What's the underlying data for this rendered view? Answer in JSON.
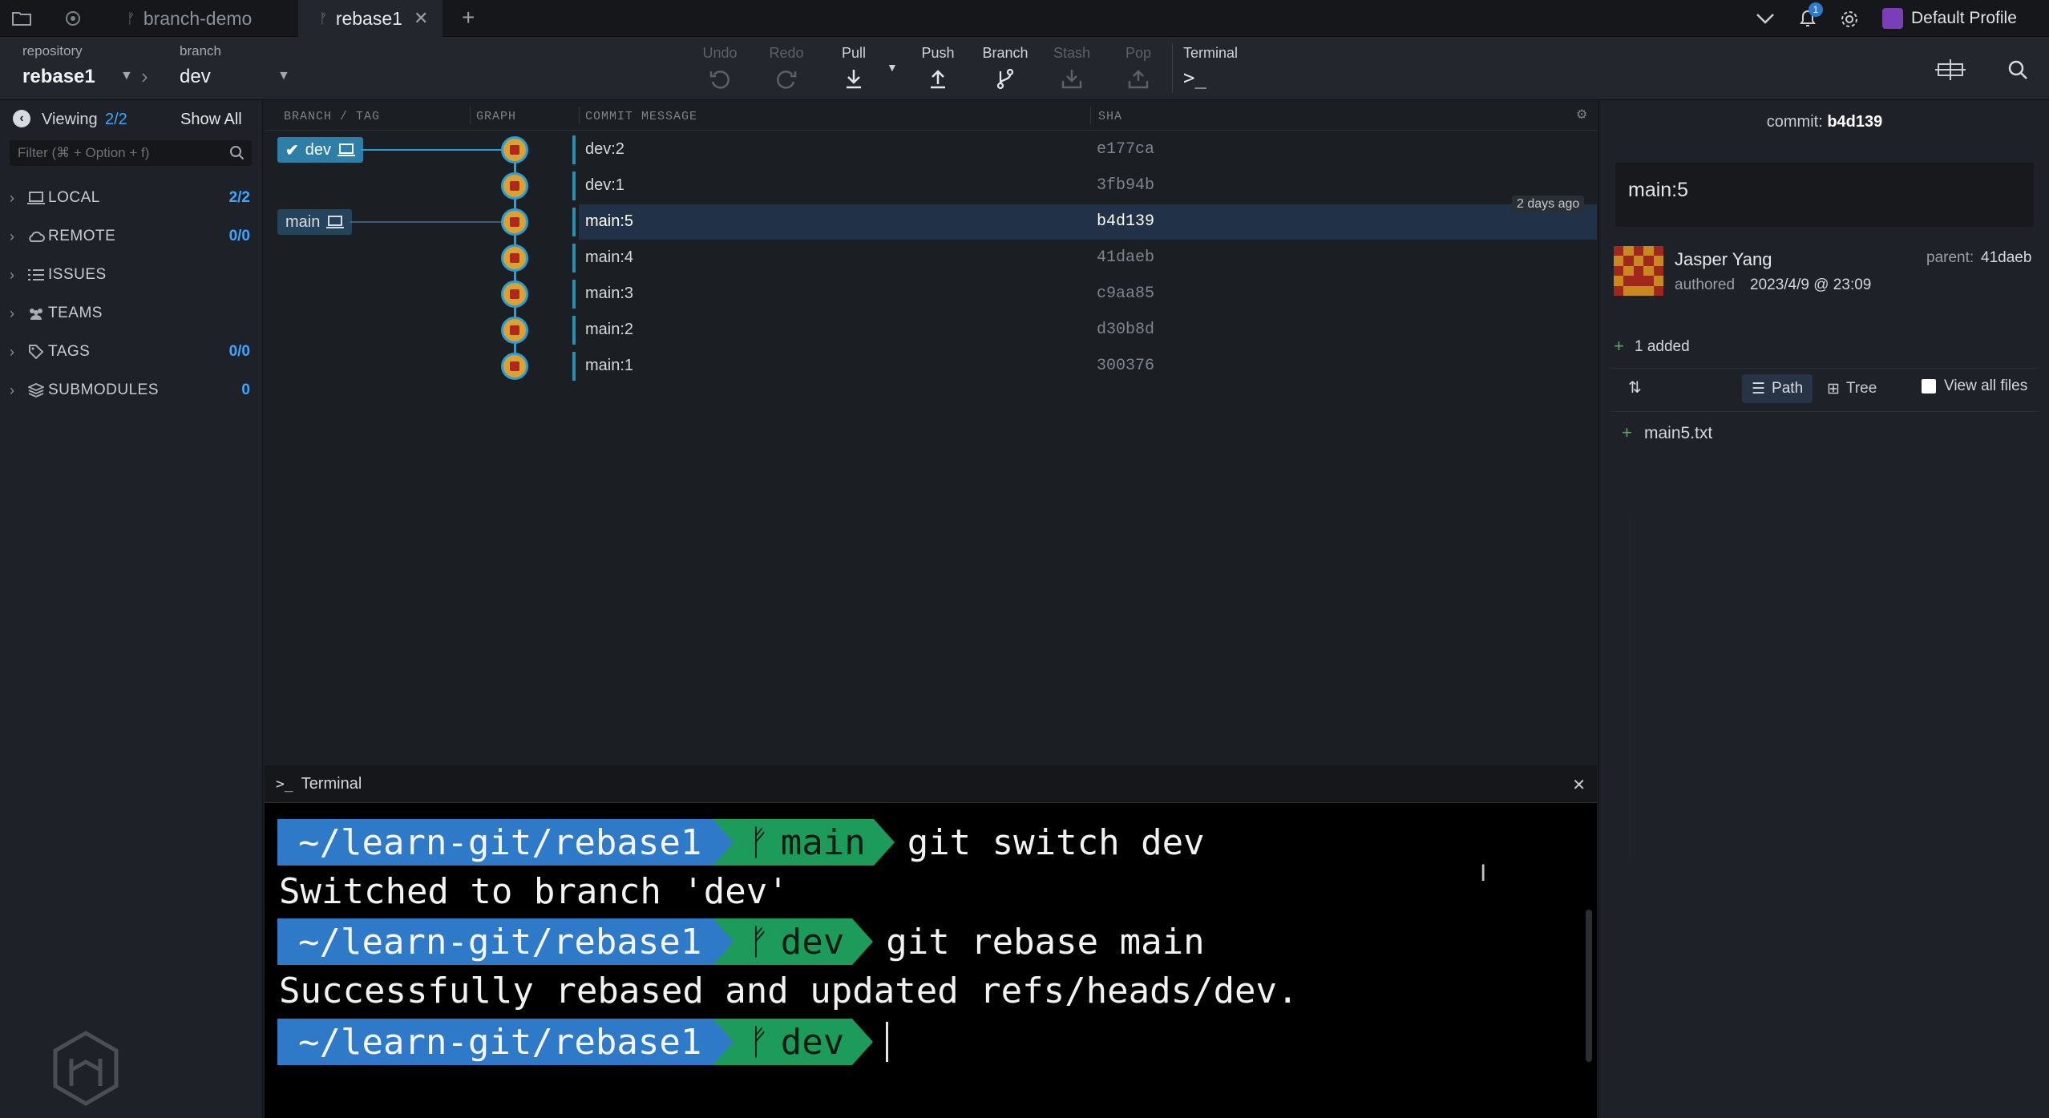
{
  "tabbar": {
    "tabs": [
      {
        "label": "branch-demo"
      },
      {
        "label": "rebase1"
      }
    ],
    "profile_label": "Default Profile",
    "notification_count": "1"
  },
  "toolbar": {
    "repo_caption": "repository",
    "repo_name": "rebase1",
    "branch_caption": "branch",
    "branch_name": "dev",
    "undo": "Undo",
    "redo": "Redo",
    "pull": "Pull",
    "push": "Push",
    "branch": "Branch",
    "stash": "Stash",
    "pop": "Pop",
    "terminal": "Terminal"
  },
  "sidebar": {
    "viewing_label": "Viewing",
    "viewing_count": "2/2",
    "show_all": "Show All",
    "filter_placeholder": "Filter (⌘ + Option + f)",
    "sections": [
      {
        "name": "LOCAL",
        "count": "2/2",
        "icon": "laptop-icon"
      },
      {
        "name": "REMOTE",
        "count": "0/0",
        "icon": "cloud-icon"
      },
      {
        "name": "ISSUES",
        "count": "",
        "icon": "list-icon"
      },
      {
        "name": "TEAMS",
        "count": "",
        "icon": "people-icon"
      },
      {
        "name": "TAGS",
        "count": "0/0",
        "icon": "tag-icon"
      },
      {
        "name": "SUBMODULES",
        "count": "0",
        "icon": "stack-icon"
      }
    ]
  },
  "graph": {
    "headers": {
      "branch_tag": "BRANCH / TAG",
      "graph": "GRAPH",
      "commit_message": "COMMIT MESSAGE",
      "sha": "SHA"
    },
    "branch_labels": {
      "dev": "dev",
      "main": "main"
    },
    "time_badge": "2 days ago",
    "commits": [
      {
        "message": "dev:2",
        "sha": "e177ca"
      },
      {
        "message": "dev:1",
        "sha": "3fb94b"
      },
      {
        "message": "main:5",
        "sha": "b4d139"
      },
      {
        "message": "main:4",
        "sha": "41daeb"
      },
      {
        "message": "main:3",
        "sha": "c9aa85"
      },
      {
        "message": "main:2",
        "sha": "d30b8d"
      },
      {
        "message": "main:1",
        "sha": "300376"
      }
    ]
  },
  "terminal": {
    "title": "Terminal",
    "lines": [
      {
        "type": "prompt",
        "path": "~/learn-git/rebase1",
        "branch": "main",
        "command": "git switch dev"
      },
      {
        "type": "output",
        "text": "Switched to branch 'dev'"
      },
      {
        "type": "prompt",
        "path": "~/learn-git/rebase1",
        "branch": "dev",
        "command": "git rebase main"
      },
      {
        "type": "output",
        "text": "Successfully rebased and updated refs/heads/dev."
      },
      {
        "type": "prompt",
        "path": "~/learn-git/rebase1",
        "branch": "dev",
        "command": ""
      }
    ]
  },
  "details": {
    "commit_label": "commit:",
    "commit_sha": "b4d139",
    "summary": "main:5",
    "author": "Jasper Yang",
    "authored_label": "authored",
    "authored_date": "2023/4/9 @ 23:09",
    "parent_label": "parent:",
    "parent_sha": "41daeb",
    "added_summary": "1 added",
    "path_label": "Path",
    "tree_label": "Tree",
    "view_all_label": "View all files",
    "files": [
      {
        "name": "main5.txt",
        "status": "added"
      }
    ]
  },
  "colors": {
    "accent": "#3ea6ff",
    "selected_row": "#213147",
    "prompt_path": "#2f79c9",
    "prompt_branch": "#1c9b5b",
    "added_green": "#4caf50"
  }
}
